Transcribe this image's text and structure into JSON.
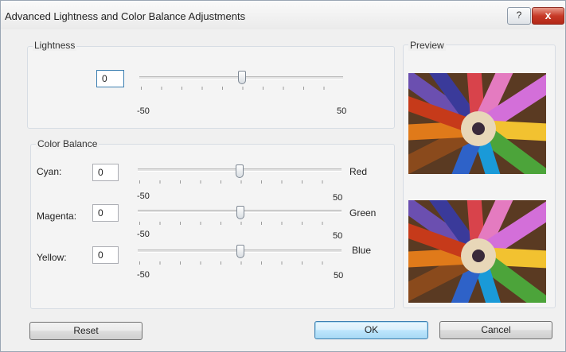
{
  "dialog": {
    "title": "Advanced Lightness and Color Balance Adjustments",
    "help_label": "?",
    "close_label": "x"
  },
  "lightness": {
    "group_label": "Lightness",
    "value": "0",
    "min_label": "-50",
    "max_label": "50",
    "level": 0
  },
  "color_balance": {
    "group_label": "Color Balance",
    "rows": [
      {
        "label": "Cyan:",
        "value": "0",
        "right_label": "Red",
        "min_label": "-50",
        "max_label": "50",
        "level": 0
      },
      {
        "label": "Magenta:",
        "value": "0",
        "right_label": "Green",
        "min_label": "-50",
        "max_label": "50",
        "level": 0
      },
      {
        "label": "Yellow:",
        "value": "0",
        "right_label": "Blue",
        "min_label": "-50",
        "max_label": "50",
        "level": 0
      }
    ]
  },
  "preview": {
    "label": "Preview"
  },
  "buttons": {
    "reset": "Reset",
    "ok": "OK",
    "cancel": "Cancel"
  }
}
